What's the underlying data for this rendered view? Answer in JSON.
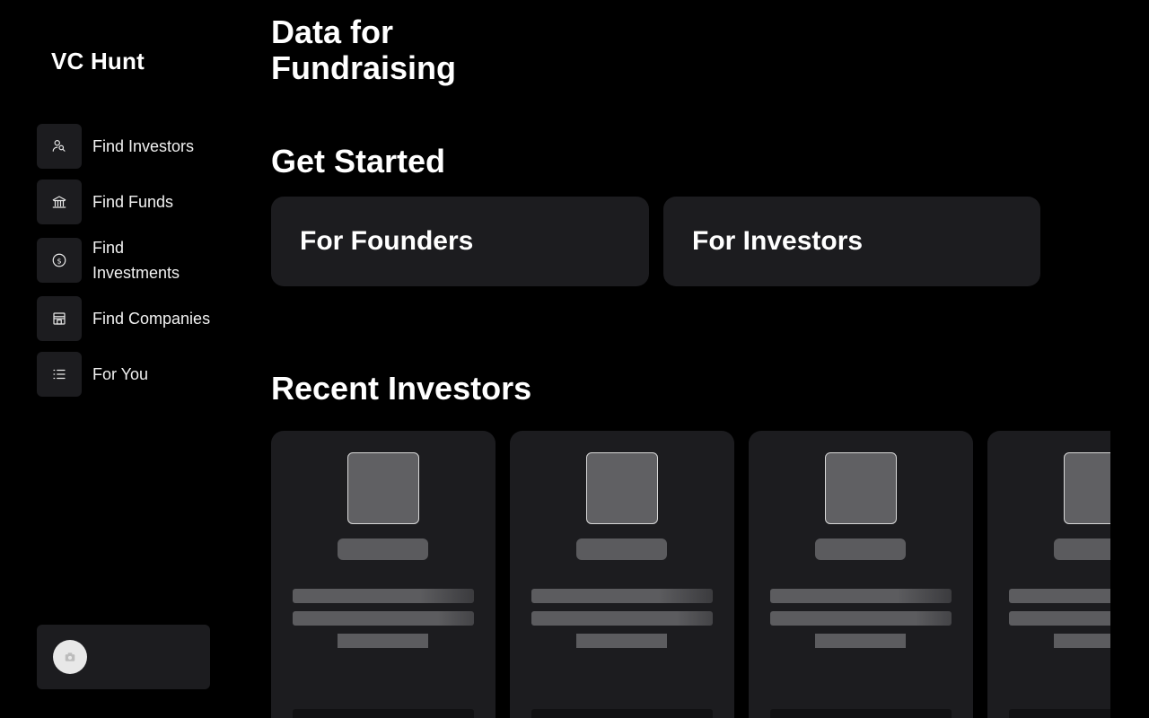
{
  "sidebar": {
    "brand": "VC Hunt",
    "items": [
      {
        "label": "Find Investors",
        "icon": "user-search-icon"
      },
      {
        "label": "Find Funds",
        "icon": "bank-icon"
      },
      {
        "label": "Find Investments",
        "icon": "dollar-circle-icon"
      },
      {
        "label": "Find Companies",
        "icon": "store-icon"
      },
      {
        "label": "For You",
        "icon": "list-icon"
      }
    ],
    "account": {
      "icon": "camera-icon"
    }
  },
  "main": {
    "hero_title": "Data for Fundraising",
    "get_started_title": "Get Started",
    "cta": {
      "founders": "For Founders",
      "investors": "For Investors"
    },
    "recent_title": "Recent Investors",
    "cards_loading": 4
  },
  "colors": {
    "background": "#000000",
    "surface": "#1c1c1f",
    "skeleton": "#5c5c5f"
  }
}
